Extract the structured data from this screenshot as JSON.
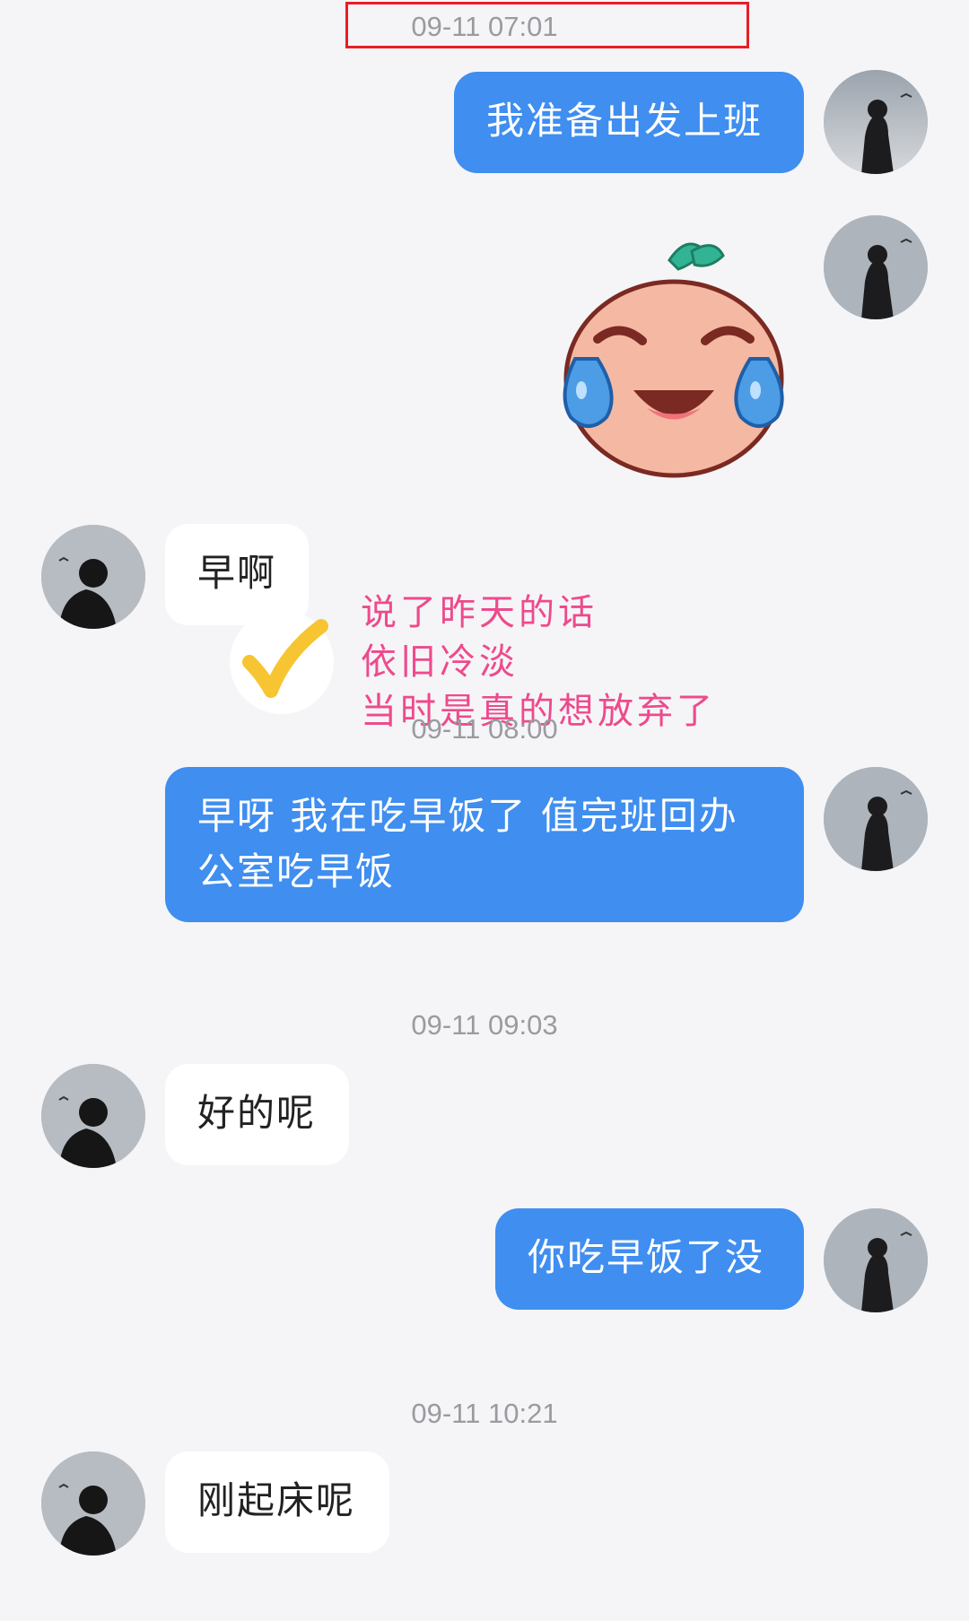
{
  "messages": {
    "ts1": "09-11 07:01",
    "m1": "我准备出发上班",
    "m2": "早啊",
    "ts2": "09-11 08:00",
    "m3": "早呀 我在吃早饭了 值完班回办公室吃早饭",
    "ts3": "09-11 09:03",
    "m4": "好的呢",
    "m5": "你吃早饭了没",
    "ts4": "09-11 10:21",
    "m6": "刚起床呢"
  },
  "annotation": {
    "line1": "说了昨天的话",
    "line2": "依旧冷淡",
    "line3": "当时是真的想放弃了",
    "color": "#ee4a8d"
  },
  "colors": {
    "sent_bubble": "#3f8ef0",
    "recv_bubble": "#ffffff",
    "background": "#f5f5f7",
    "highlight": "#e81e25"
  },
  "icons": {
    "sticker": "crying-laughing-peach-sticker-icon",
    "check": "checkmark-icon"
  }
}
